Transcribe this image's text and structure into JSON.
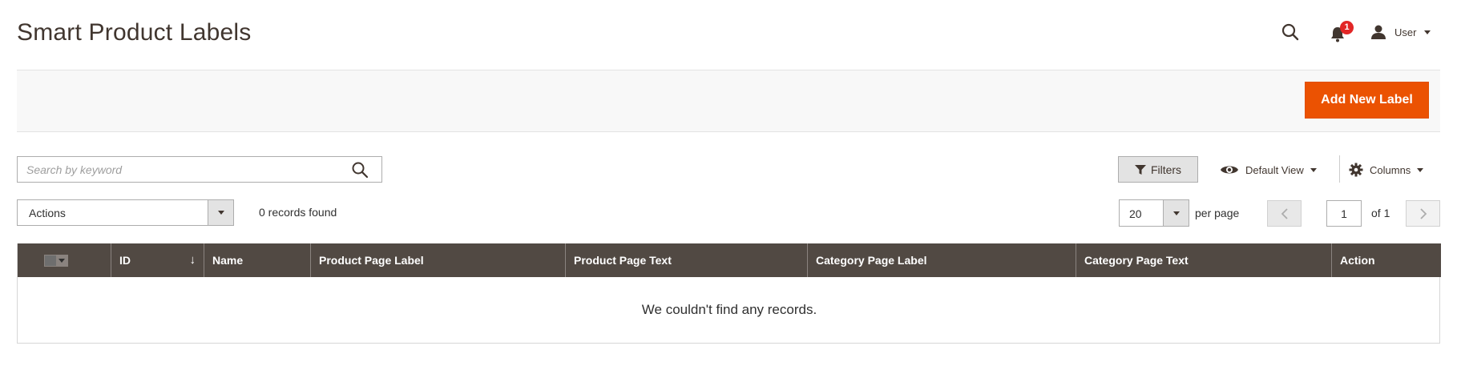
{
  "page": {
    "title": "Smart Product Labels"
  },
  "header": {
    "notifications_count": "1",
    "user_label": "User",
    "icons": {
      "search": "search-icon",
      "notifications": "bell-icon",
      "user": "user-icon"
    }
  },
  "actions_bar": {
    "add_button_label": "Add New Label",
    "accent_color": "#eb5202"
  },
  "toolbar": {
    "search_placeholder": "Search by keyword",
    "filters_label": "Filters",
    "view_label": "Default View",
    "columns_label": "Columns",
    "mass_actions_label": "Actions",
    "records_found": "0 records found",
    "per_page_value": "20",
    "per_page_label": "per page",
    "current_page": "1",
    "total_pages_label": "of 1"
  },
  "grid": {
    "header_color": "#514943",
    "columns": [
      {
        "label": ""
      },
      {
        "label": "ID"
      },
      {
        "label": "Name"
      },
      {
        "label": "Product Page Label"
      },
      {
        "label": "Product Page Text"
      },
      {
        "label": "Category Page Label"
      },
      {
        "label": "Category Page Text"
      },
      {
        "label": "Action"
      }
    ],
    "empty_message": "We couldn't find any records."
  }
}
